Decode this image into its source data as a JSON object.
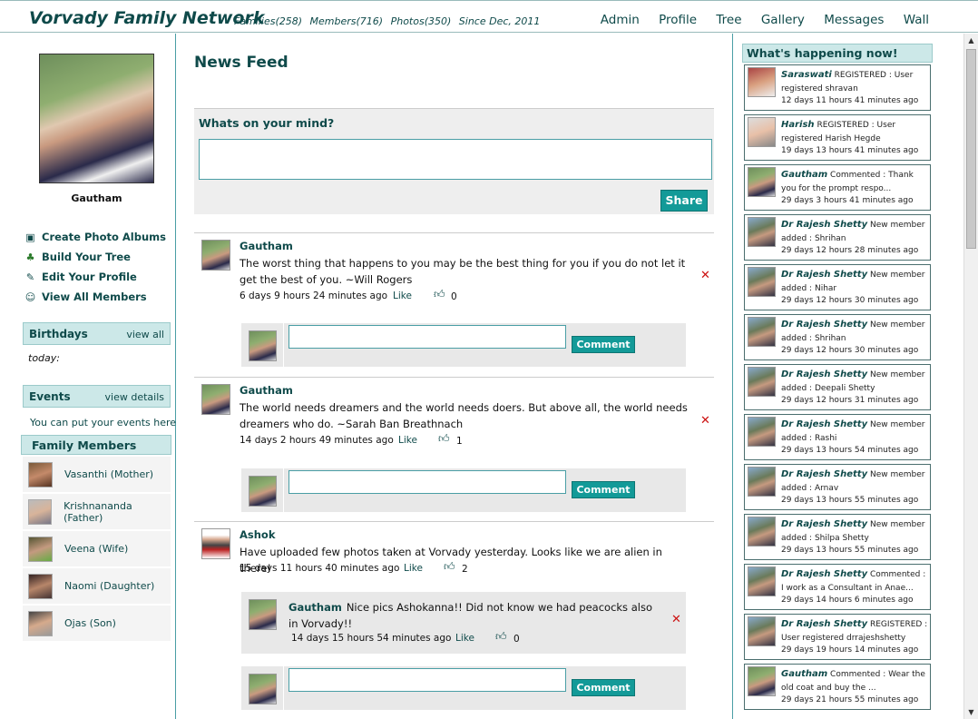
{
  "header": {
    "brand": "Vorvady Family Network",
    "stats": [
      "Families(258)",
      "Members(716)",
      "Photos(350)",
      "Since Dec, 2011"
    ],
    "nav": [
      "Admin",
      "Profile",
      "Tree",
      "Gallery",
      "Messages",
      "Wall"
    ]
  },
  "sidebar": {
    "profile_name": "Gautham",
    "links": [
      {
        "label": "Create Photo Albums",
        "icon": "photo-album-icon",
        "glyph": "▣"
      },
      {
        "label": "Build Your Tree",
        "icon": "tree-icon",
        "glyph": "♣"
      },
      {
        "label": "Edit Your Profile",
        "icon": "edit-icon",
        "glyph": "✎"
      },
      {
        "label": "View All Members",
        "icon": "members-icon",
        "glyph": "☺"
      }
    ],
    "birthdays": {
      "title": "Birthdays",
      "link": "view all",
      "today": "today:"
    },
    "events": {
      "title": "Events",
      "link": "view details",
      "text": "You can put your events here"
    },
    "family_members_title": "Family Members",
    "family_members": [
      {
        "name": "Vasanthi (Mother)"
      },
      {
        "name": "Krishnananda (Father)"
      },
      {
        "name": "Veena (Wife)"
      },
      {
        "name": "Naomi (Daughter)"
      },
      {
        "name": "Ojas (Son)"
      }
    ]
  },
  "main": {
    "title": "News Feed",
    "mind_label": "Whats on your mind?",
    "share_label": "Share",
    "comment_label": "Comment",
    "like_label": "Like",
    "posts": [
      {
        "author": "Gautham",
        "text": "The worst thing that happens to you may be the best thing for you if you do not let it get the best of you. ~Will Rogers",
        "time": "6 days 9 hours 24 minutes ago",
        "likes": "0"
      },
      {
        "author": "Gautham",
        "text": "The world needs dreamers and the world needs doers. But above all, the world needs dreamers who do. ~Sarah Ban Breathnach",
        "time": "14 days 2 hours 49 minutes ago",
        "likes": "1"
      },
      {
        "author": "Ashok",
        "text": "Have uploaded few photos taken at Vorvady yesterday. Looks like we are alien in there!",
        "time": "15 days 11 hours 40 minutes ago",
        "likes": "2",
        "reply": {
          "author": "Gautham",
          "text": "Nice pics Ashokanna!! Did not know we had peacocks also in Vorvady!!",
          "time": "14 days 15 hours 54 minutes ago",
          "likes": "0"
        }
      }
    ]
  },
  "activity": {
    "title": "What's happening now!",
    "items": [
      {
        "who": "Saraswati",
        "action": "REGISTERED :",
        "detail": "User registered shravan",
        "time": "12 days 11 hours 41 minutes ago"
      },
      {
        "who": "Harish",
        "action": "REGISTERED :",
        "detail": "User registered Harish Hegde",
        "time": "19 days 13 hours 41 minutes ago"
      },
      {
        "who": "Gautham",
        "action": "Commented :",
        "detail": "Thank you for the prompt respo...",
        "time": "29 days 3 hours 41 minutes ago"
      },
      {
        "who": "Dr Rajesh Shetty",
        "action": "New member added :",
        "detail": "Shrihan",
        "time": "29 days 12 hours 28 minutes ago"
      },
      {
        "who": "Dr Rajesh Shetty",
        "action": "New member added :",
        "detail": "Nihar",
        "time": "29 days 12 hours 30 minutes ago"
      },
      {
        "who": "Dr Rajesh Shetty",
        "action": "New member added :",
        "detail": "Shrihan",
        "time": "29 days 12 hours 30 minutes ago"
      },
      {
        "who": "Dr Rajesh Shetty",
        "action": "New member added :",
        "detail": "Deepali Shetty",
        "time": "29 days 12 hours 31 minutes ago"
      },
      {
        "who": "Dr Rajesh Shetty",
        "action": "New member added :",
        "detail": "Rashi",
        "time": "29 days 13 hours 54 minutes ago"
      },
      {
        "who": "Dr Rajesh Shetty",
        "action": "New member added :",
        "detail": "Arnav",
        "time": "29 days 13 hours 55 minutes ago"
      },
      {
        "who": "Dr Rajesh Shetty",
        "action": "New member added :",
        "detail": "Shilpa Shetty",
        "time": "29 days 13 hours 55 minutes ago"
      },
      {
        "who": "Dr Rajesh Shetty",
        "action": "Commented :",
        "detail": "I work as a Consultant in Anae...",
        "time": "29 days 14 hours 6 minutes ago"
      },
      {
        "who": "Dr Rajesh Shetty",
        "action": "REGISTERED :",
        "detail": "User registered drrajeshshetty",
        "time": "29 days 19 hours 14 minutes ago"
      },
      {
        "who": "Gautham",
        "action": "Commented :",
        "detail": "Wear the old coat and buy the ...",
        "time": "29 days 21 hours 55 minutes ago"
      }
    ]
  }
}
